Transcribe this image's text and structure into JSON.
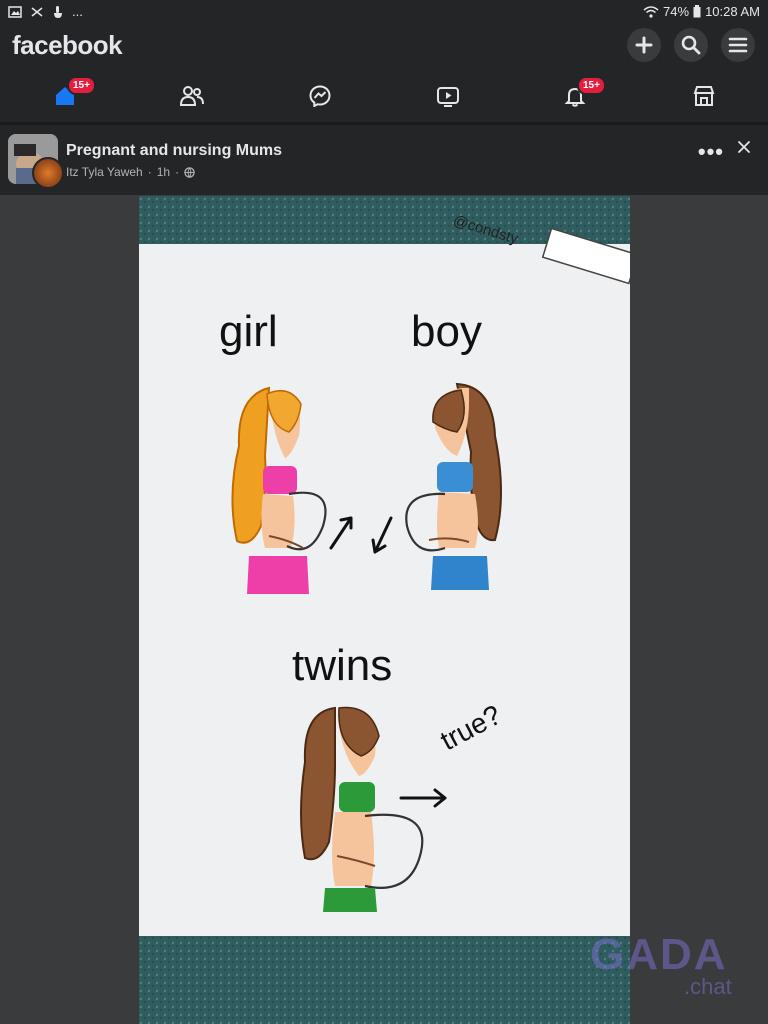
{
  "status_bar": {
    "left_dots": "...",
    "battery_pct": "74%",
    "time": "10:28 AM"
  },
  "header": {
    "logo": "facebook"
  },
  "nav": {
    "home_badge": "15+",
    "notifications_badge": "15+"
  },
  "post": {
    "group_name": "Pregnant and nursing Mums",
    "author": "Itz Tyla Yaweh",
    "time": "1h",
    "separator": "·",
    "more": "•••"
  },
  "image": {
    "handle": "@condsty",
    "label_girl": "girl",
    "label_boy": "boy",
    "label_twins": "twins",
    "label_true": "true?"
  },
  "watermark": {
    "text": "GADA",
    "sub": ".chat"
  },
  "colors": {
    "accent": "#1877f2",
    "badge": "#e41e3f",
    "background": "#242526"
  }
}
